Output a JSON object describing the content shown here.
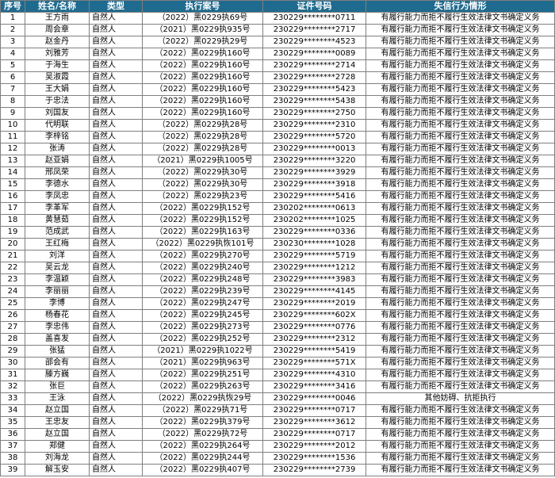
{
  "headers": [
    "序号",
    "姓名/名称",
    "类型",
    "执行案号",
    "证件号码",
    "失信行为情形"
  ],
  "rows": [
    [
      "1",
      "王方雨",
      "自然人",
      "（2022）黑0229执69号",
      "230229********0711",
      "有履行能力而拒不履行生效法律文书确定义务"
    ],
    [
      "2",
      "周会章",
      "自然人",
      "（2021）黑0229执935号",
      "230229********2717",
      "有履行能力而拒不履行生效法律文书确定义务"
    ],
    [
      "3",
      "赵金丹",
      "自然人",
      "（2022）黑0229执29号",
      "230229********4523",
      "有履行能力而拒不履行生效法律文书确定义务"
    ],
    [
      "4",
      "刘雅芳",
      "自然人",
      "（2022）黑0229执160号",
      "230229********0089",
      "有履行能力而拒不履行生效法律文书确定义务"
    ],
    [
      "5",
      "于海生",
      "自然人",
      "（2022）黑0229执160号",
      "230229********2714",
      "有履行能力而拒不履行生效法律文书确定义务"
    ],
    [
      "6",
      "吴淑霞",
      "自然人",
      "（2022）黑0229执160号",
      "230229********2728",
      "有履行能力而拒不履行生效法律文书确定义务"
    ],
    [
      "7",
      "王大娟",
      "自然人",
      "（2022）黑0229执160号",
      "230229********5423",
      "有履行能力而拒不履行生效法律文书确定义务"
    ],
    [
      "8",
      "于忠法",
      "自然人",
      "（2022）黑0229执160号",
      "230229********5438",
      "有履行能力而拒不履行生效法律文书确定义务"
    ],
    [
      "9",
      "刘国友",
      "自然人",
      "（2022）黑0229执160号",
      "230229********2750",
      "有履行能力而拒不履行生效法律文书确定义务"
    ],
    [
      "10",
      "代明联",
      "自然人",
      "（2022）黑0229执28号",
      "230229********2310",
      "有履行能力而拒不履行生效法律文书确定义务"
    ],
    [
      "11",
      "李梓铭",
      "自然人",
      "（2022）黑0229执28号",
      "230229********5720",
      "有履行能力而拒不履行生效法律文书确定义务"
    ],
    [
      "12",
      "张涛",
      "自然人",
      "（2022）黑0229执28号",
      "230229********0013",
      "有履行能力而拒不履行生效法律文书确定义务"
    ],
    [
      "13",
      "赵亚娟",
      "自然人",
      "（2021）黑0229执1005号",
      "230229********3220",
      "有履行能力而拒不履行生效法律文书确定义务"
    ],
    [
      "14",
      "邢凤荣",
      "自然人",
      "（2022）黑0229执30号",
      "230229********3929",
      "有履行能力而拒不履行生效法律文书确定义务"
    ],
    [
      "15",
      "李德水",
      "自然人",
      "（2022）黑0229执30号",
      "230229********3918",
      "有履行能力而拒不履行生效法律文书确定义务"
    ],
    [
      "16",
      "李凤忠",
      "自然人",
      "（2022）黑0229执23号",
      "230229********5416",
      "有履行能力而拒不履行生效法律文书确定义务"
    ],
    [
      "17",
      "李革军",
      "自然人",
      "（2022）黑0229执152号",
      "230202********0613",
      "有履行能力而拒不履行生效法律文书确定义务"
    ],
    [
      "18",
      "黄慧茹",
      "自然人",
      "（2022）黑0229执152号",
      "230202********1025",
      "有履行能力而拒不履行生效法律文书确定义务"
    ],
    [
      "19",
      "范成武",
      "自然人",
      "（2022）黑0229执163号",
      "230229********0336",
      "有履行能力而拒不履行生效法律文书确定义务"
    ],
    [
      "20",
      "王红梅",
      "自然人",
      "（2022）黑0229执恢101号",
      "230230********1028",
      "有履行能力而拒不履行生效法律文书确定义务"
    ],
    [
      "21",
      "刘洋",
      "自然人",
      "（2022）黑0229执270号",
      "230229********5719",
      "有履行能力而拒不履行生效法律文书确定义务"
    ],
    [
      "22",
      "吴云龙",
      "自然人",
      "（2022）黑0229执240号",
      "230229********1212",
      "有履行能力而拒不履行生效法律文书确定义务"
    ],
    [
      "23",
      "李温颖",
      "自然人",
      "（2022）黑0229执248号",
      "230229********3983",
      "有履行能力而拒不履行生效法律文书确定义务"
    ],
    [
      "24",
      "李丽丽",
      "自然人",
      "（2022）黑0229执239号",
      "230229********4145",
      "有履行能力而拒不履行生效法律文书确定义务"
    ],
    [
      "25",
      "李博",
      "自然人",
      "（2022）黑0229执247号",
      "230229********2019",
      "有履行能力而拒不履行生效法律文书确定义务"
    ],
    [
      "26",
      "杨春花",
      "自然人",
      "（2022）黑0229执245号",
      "230229********602X",
      "有履行能力而拒不履行生效法律文书确定义务"
    ],
    [
      "27",
      "李忠伟",
      "自然人",
      "（2022）黑0229执273号",
      "230229********0776",
      "有履行能力而拒不履行生效法律文书确定义务"
    ],
    [
      "28",
      "盖喜发",
      "自然人",
      "（2022）黑0229执252号",
      "230229********2312",
      "有履行能力而拒不履行生效法律文书确定义务"
    ],
    [
      "29",
      "张猛",
      "自然人",
      "（2021）黑0229执1022号",
      "230229********5419",
      "有履行能力而拒不履行生效法律文书确定义务"
    ],
    [
      "30",
      "邵会有",
      "自然人",
      "（2021）黑0229执963号",
      "230229********571X",
      "有履行能力而拒不履行生效法律文书确定义务"
    ],
    [
      "31",
      "滕方巍",
      "自然人",
      "（2022）黑0229执251号",
      "230229********4310",
      "有履行能力而拒不履行生效法律文书确定义务"
    ],
    [
      "32",
      "张巨",
      "自然人",
      "（2022）黑0229执263号",
      "230229********3416",
      "有履行能力而拒不履行生效法律文书确定义务"
    ],
    [
      "33",
      "王泳",
      "自然人",
      "（2022）黑0229执恢29号",
      "230229********0046",
      "其他妨碍、抗拒执行"
    ],
    [
      "34",
      "赵立国",
      "自然人",
      "（2022）黑0229执71号",
      "230229********0717",
      "有履行能力而拒不履行生效法律文书确定义务"
    ],
    [
      "35",
      "王忠友",
      "自然人",
      "（2022）黑0229执379号",
      "230229********3612",
      "有履行能力而拒不履行生效法律文书确定义务"
    ],
    [
      "36",
      "赵立国",
      "自然人",
      "（2022）黑0229执72号",
      "230229********0717",
      "有履行能力而拒不履行生效法律文书确定义务"
    ],
    [
      "37",
      "郑健",
      "自然人",
      "（2022）黑0229执264号",
      "230229********2012",
      "有履行能力而拒不履行生效法律文书确定义务"
    ],
    [
      "38",
      "刘海龙",
      "自然人",
      "（2022）黑0229执244号",
      "230229********1536",
      "有履行能力而拒不履行生效法律文书确定义务"
    ],
    [
      "39",
      "解玉安",
      "自然人",
      "（2022）黑0229执407号",
      "230229********2739",
      "有履行能力而拒不履行生效法律文书确定义务"
    ]
  ],
  "colors": {
    "header_bg": "#1f6b8f",
    "header_text": "#ffffff",
    "border": "#7f7f7f"
  }
}
